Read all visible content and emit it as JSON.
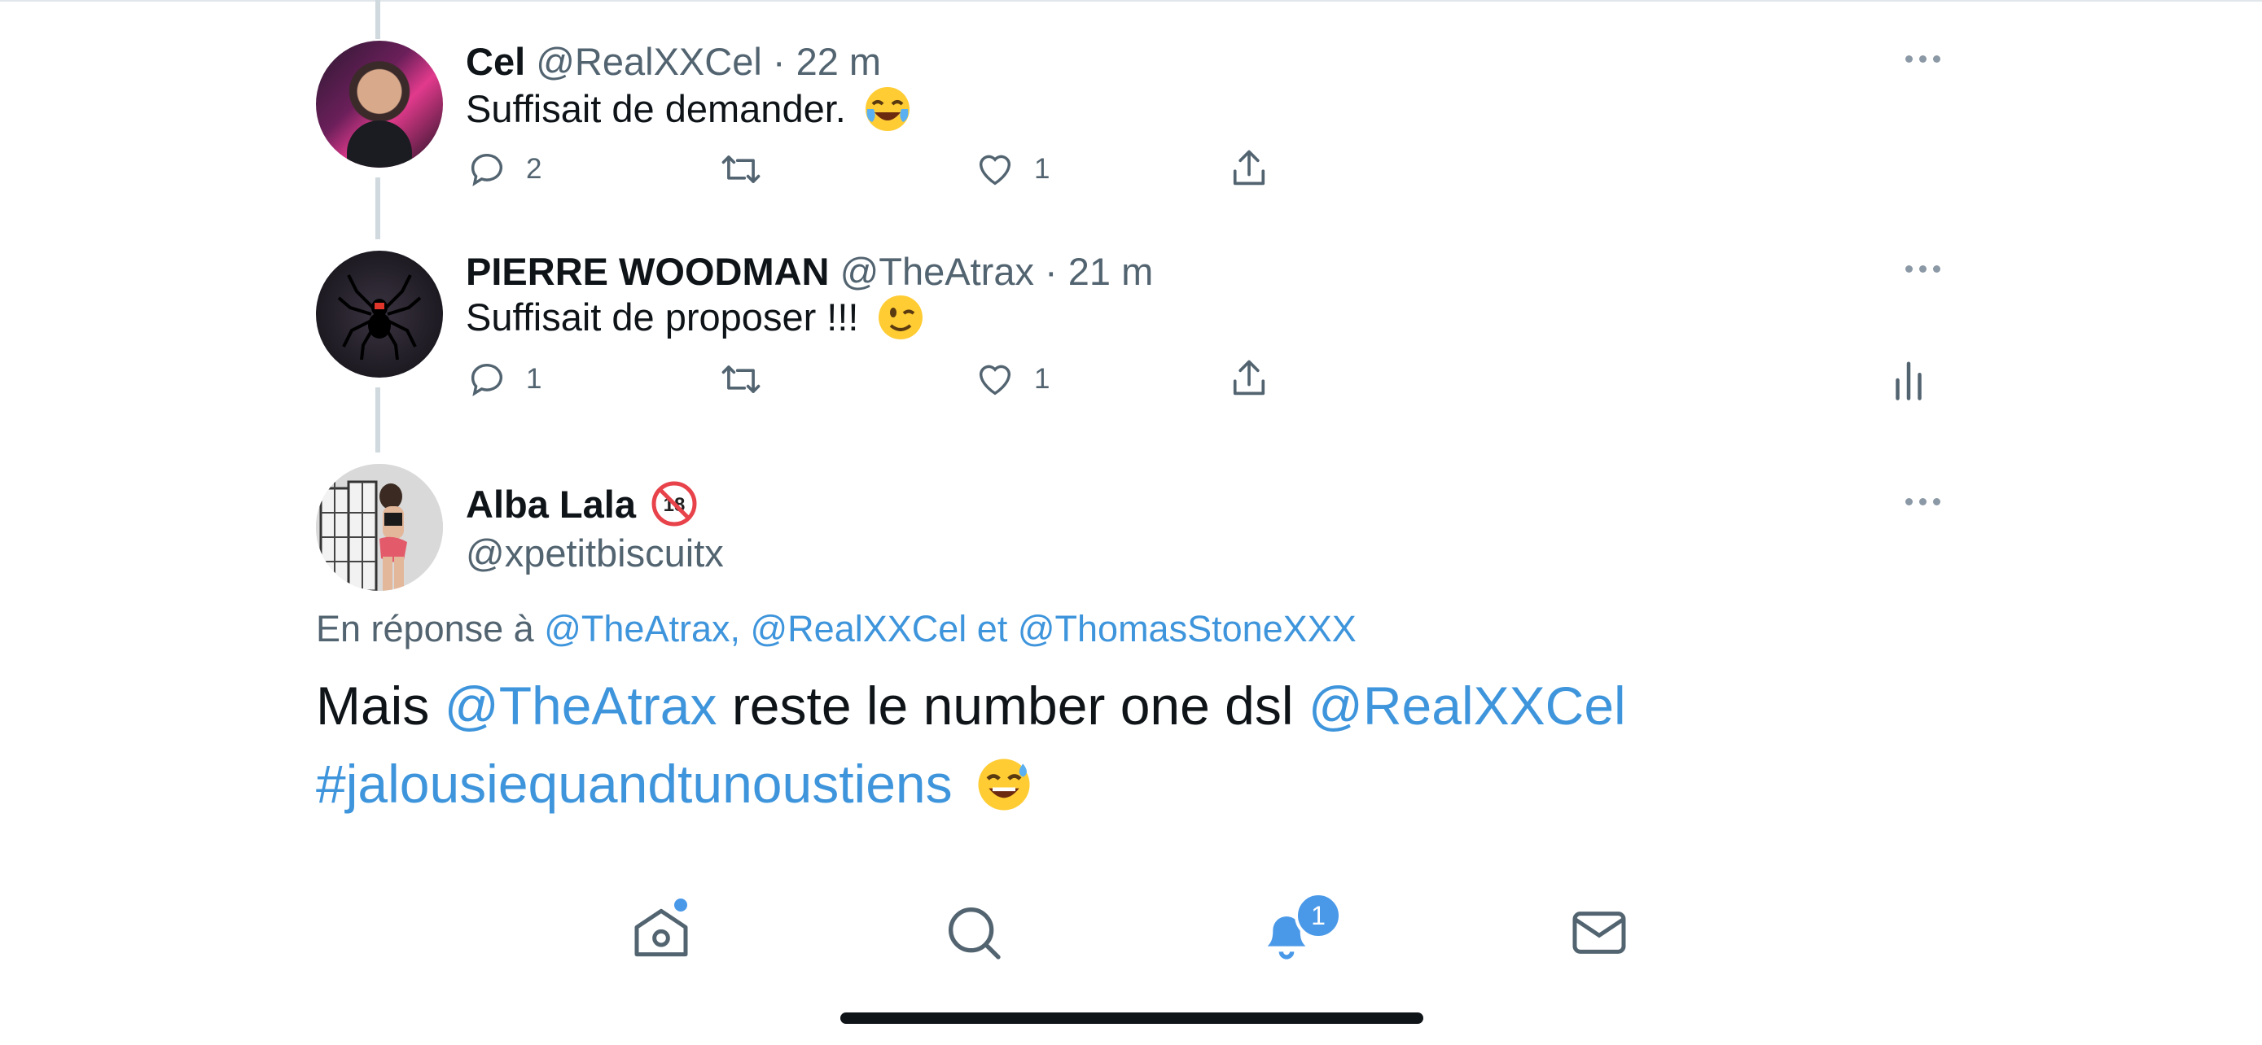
{
  "colors": {
    "link": "#3e95dc",
    "meta": "#536471",
    "accent": "#4a99e9",
    "icon": "#536471"
  },
  "tweets": [
    {
      "name": "Cel",
      "handle": "@RealXXCel",
      "sep": "·",
      "time": "22 m",
      "text": "Suffisait de demander.",
      "emoji": "joy",
      "replies": "2",
      "likes": "1"
    },
    {
      "name": "PIERRE WOODMAN",
      "handle": "@TheAtrax",
      "sep": "·",
      "time": "21 m",
      "text": "Suffisait de proposer !!!",
      "emoji": "wink",
      "replies": "1",
      "likes": "1"
    }
  ],
  "main": {
    "name": "Alba Lala",
    "name_emoji": "no-one-under-18",
    "handle": "@xpetitbiscuitx",
    "reply_prefix": "En réponse à",
    "reply_m1": "@TheAtrax,",
    "reply_m2": "@RealXXCel",
    "reply_and": "et",
    "reply_m3": "@ThomasStoneXXX",
    "t1": "Mais",
    "t_m1": "@TheAtrax",
    "t2": "reste le number one dsl",
    "t_m2": "@RealXXCel",
    "hashtag": "#jalousiequandtunoustiens",
    "end_emoji": "sweat-smile"
  },
  "tabbar": {
    "notifications_badge": "1"
  }
}
